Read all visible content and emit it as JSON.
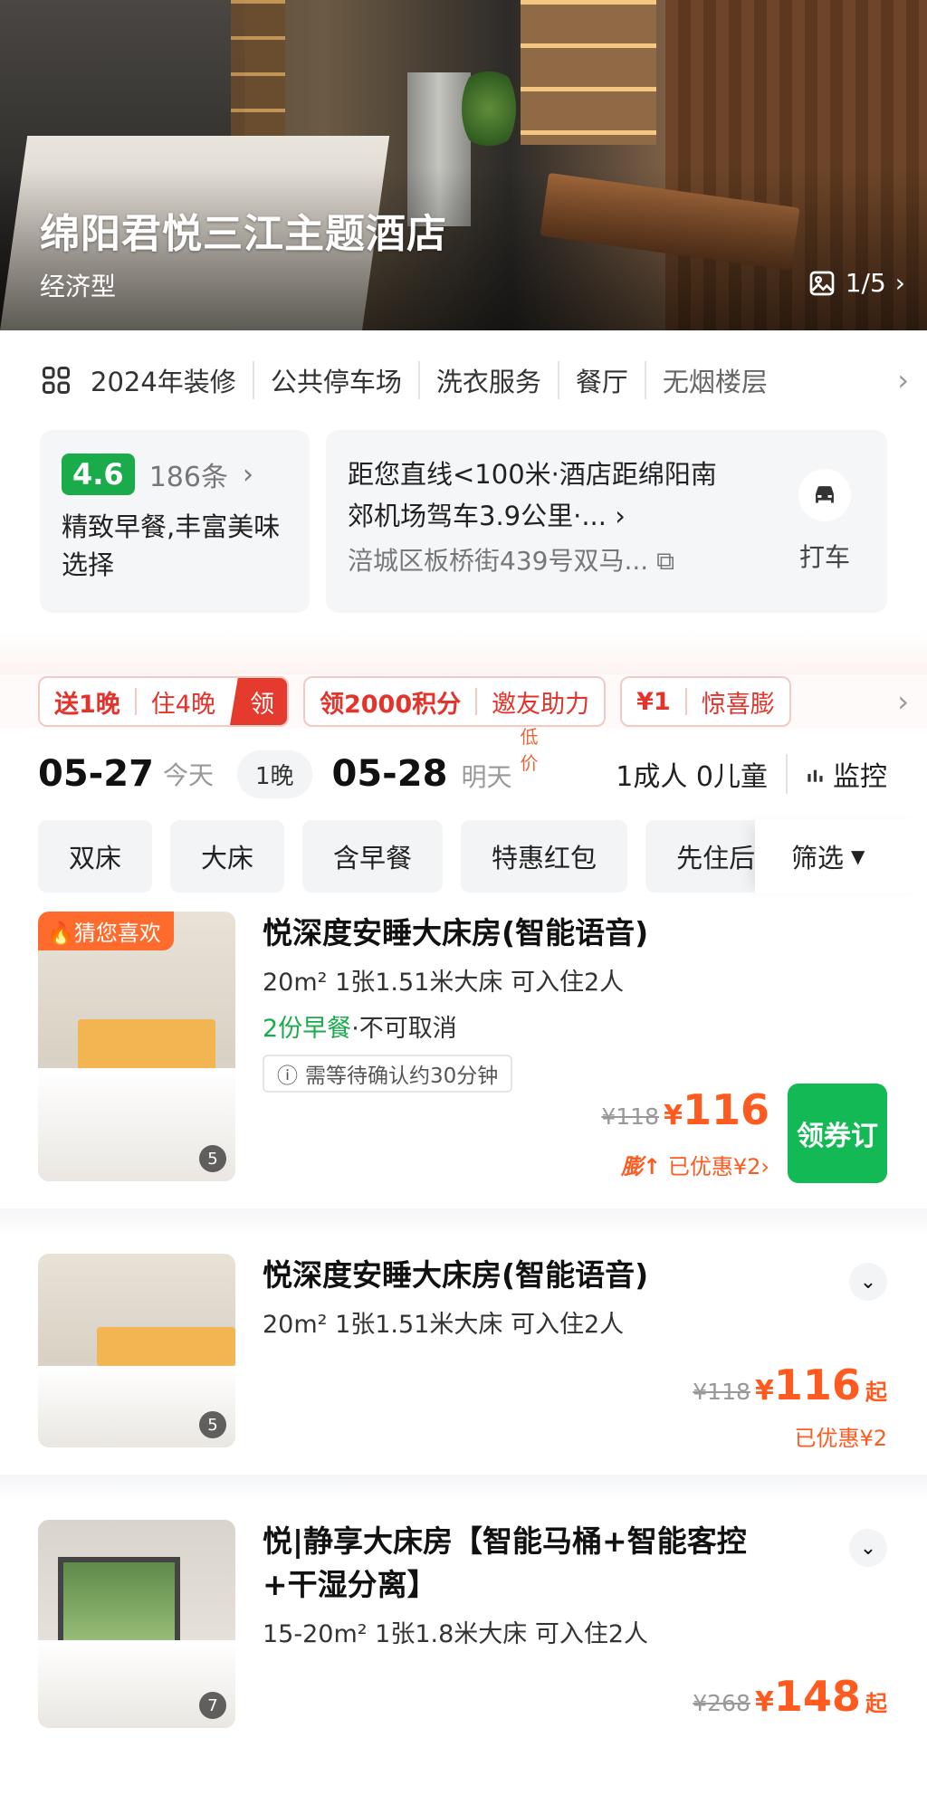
{
  "hero": {
    "title": "绵阳君悦三江主题酒店",
    "subtitle": "经济型",
    "photo_counter": "1/5"
  },
  "facilities": [
    "2024年装修",
    "公共停车场",
    "洗衣服务",
    "餐厅",
    "无烟楼层"
  ],
  "rating": {
    "score": "4.6",
    "reviews": "186条",
    "description": "精致早餐,丰富美味选择"
  },
  "location": {
    "line1": "距您直线<100米·酒店距绵阳南",
    "line2": "郊机场驾车3.9公里·...",
    "address": "涪城区板桥街439号双马...",
    "taxi_label": "打车"
  },
  "promos": [
    {
      "parts": [
        "送1晚",
        "住4晚"
      ],
      "cta": "领"
    },
    {
      "parts": [
        "领2000积分",
        "邀友助力"
      ]
    },
    {
      "parts": [
        "¥1",
        "惊喜膨"
      ]
    }
  ],
  "dates": {
    "checkin": "05-27",
    "checkin_label": "今天",
    "nights": "1晚",
    "checkout": "05-28",
    "checkout_label": "明天",
    "low_price_badge": "低价",
    "guests": "1成人 0儿童",
    "monitor": "监控"
  },
  "filters": [
    "双床",
    "大床",
    "含早餐",
    "特惠红包",
    "先住后"
  ],
  "filter_button": "筛选",
  "rooms": [
    {
      "tag": "猜您喜欢",
      "name": "悦深度安睡大床房(智能语音)",
      "spec": "20m² 1张1.51米大床 可入住2人",
      "meal_green": "2份早餐",
      "meal_rest": "·不可取消",
      "wait": "需等待确认约30分钟",
      "old_price": "¥118",
      "price": "116",
      "discount_prefix": "膨",
      "discount": "已优惠¥2",
      "button": "领券订",
      "photos": "5"
    },
    {
      "name": "悦深度安睡大床房(智能语音)",
      "spec": "20m² 1张1.51米大床 可入住2人",
      "old_price": "¥118",
      "price": "116",
      "suffix": "起",
      "discount": "已优惠¥2",
      "photos": "5"
    },
    {
      "name": "悦|静享大床房【智能马桶+智能客控+干湿分离】",
      "spec": "15-20m² 1张1.8米大床 可入住2人",
      "old_price": "¥268",
      "price": "148",
      "suffix": "起",
      "photos": "7"
    }
  ],
  "colors": {
    "accent_orange": "#ff5a1f",
    "rating_green": "#1aab4a",
    "book_green": "#12b955",
    "promo_red": "#e3332b"
  }
}
